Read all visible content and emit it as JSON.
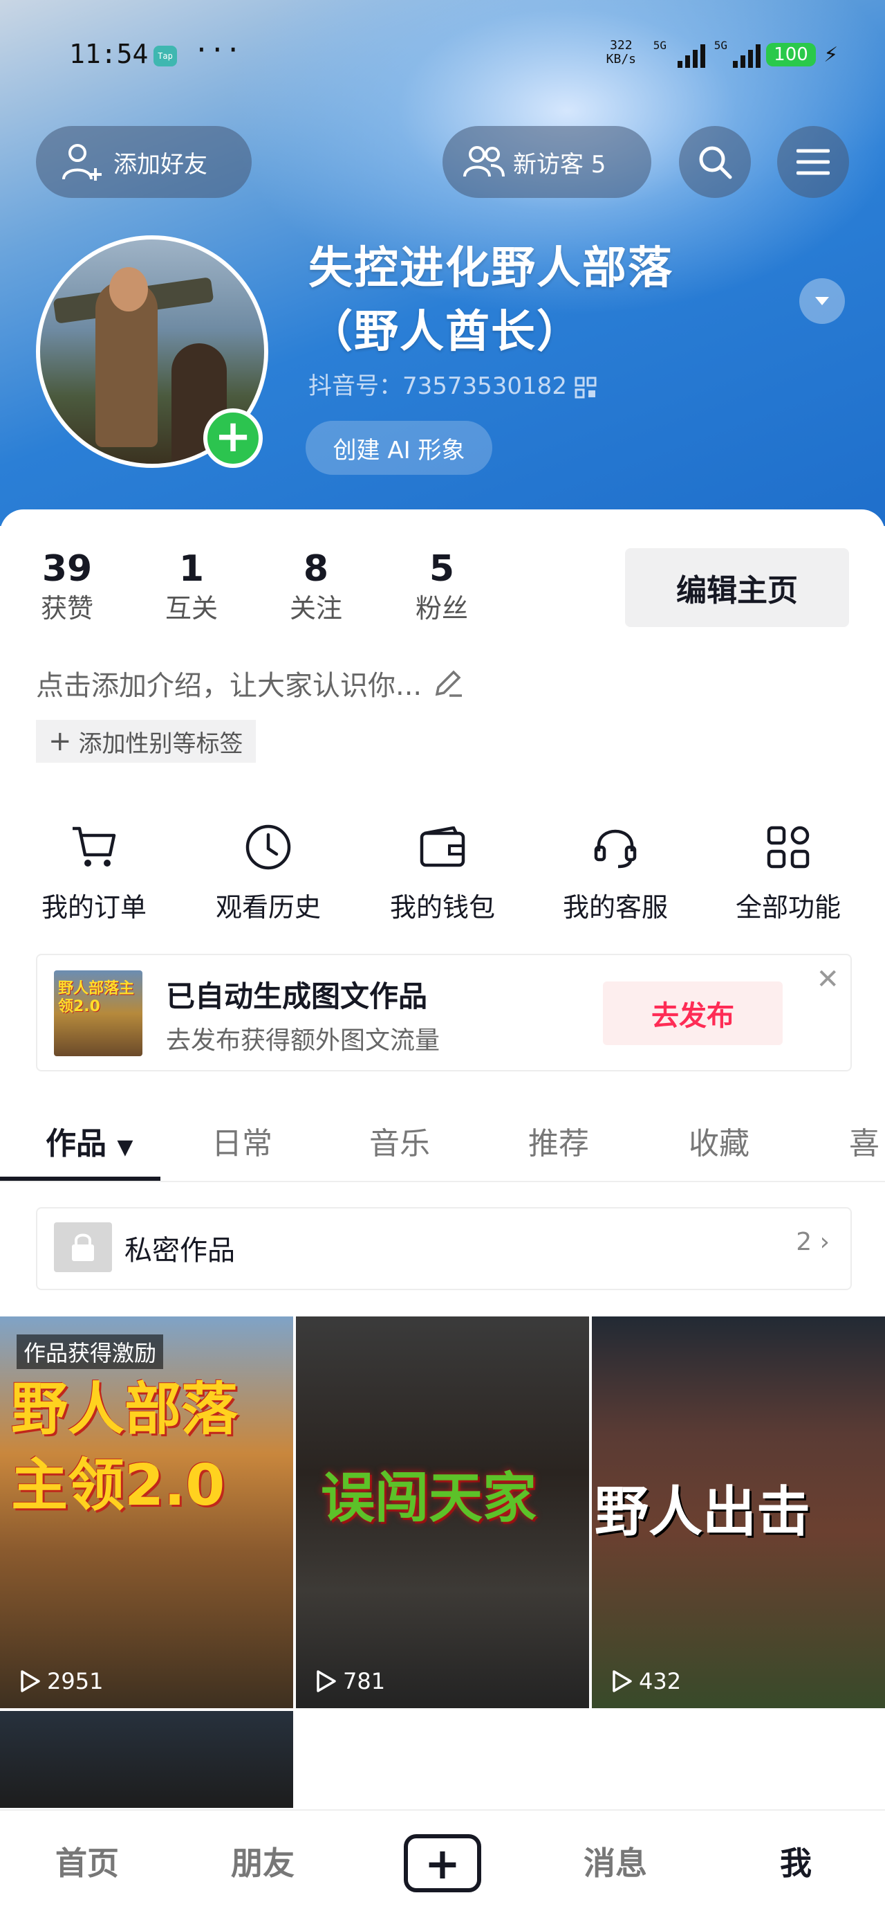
{
  "status_bar": {
    "time": "11:54",
    "tap_badge": "Tap",
    "dots": "···",
    "net_speed_top": "322",
    "net_speed_bottom": "KB/s",
    "sim1": "5G",
    "sim2": "5G",
    "battery": "100"
  },
  "header": {
    "add_friend": "添加好友",
    "new_visitors": "新访客 5",
    "nickname_line1": "失控进化野人部落",
    "nickname_line2": "（野人酋长）",
    "douyin_id": "抖音号：73573530182",
    "create_ai": "创建 AI 形象"
  },
  "stats": [
    {
      "num": "39",
      "label": "获赞"
    },
    {
      "num": "1",
      "label": "互关"
    },
    {
      "num": "8",
      "label": "关注"
    },
    {
      "num": "5",
      "label": "粉丝"
    }
  ],
  "edit_profile": "编辑主页",
  "intro": "点击添加介绍，让大家认识你...",
  "add_tags": "添加性别等标签",
  "functions": [
    {
      "label": "我的订单",
      "icon": "cart-icon"
    },
    {
      "label": "观看历史",
      "icon": "clock-icon"
    },
    {
      "label": "我的钱包",
      "icon": "wallet-icon"
    },
    {
      "label": "我的客服",
      "icon": "headset-icon"
    },
    {
      "label": "全部功能",
      "icon": "grid-icon"
    }
  ],
  "notice": {
    "thumb_text": "野人部落主领2.0",
    "title": "已自动生成图文作品",
    "subtitle": "去发布获得额外图文流量",
    "button": "去发布",
    "close": "✕"
  },
  "tabs": [
    "作品",
    "日常",
    "音乐",
    "推荐",
    "收藏",
    "喜"
  ],
  "private": {
    "label": "私密作品",
    "count": "2"
  },
  "videos": [
    {
      "badge": "作品获得激励",
      "title_line1": "野人部落",
      "title_line2": "主领2.0",
      "plays": "2951"
    },
    {
      "title": "误闯天家",
      "plays": "781"
    },
    {
      "title": "野人出击",
      "plays": "432"
    }
  ],
  "bottom_nav": {
    "home": "首页",
    "friends": "朋友",
    "messages": "消息",
    "me": "我"
  }
}
